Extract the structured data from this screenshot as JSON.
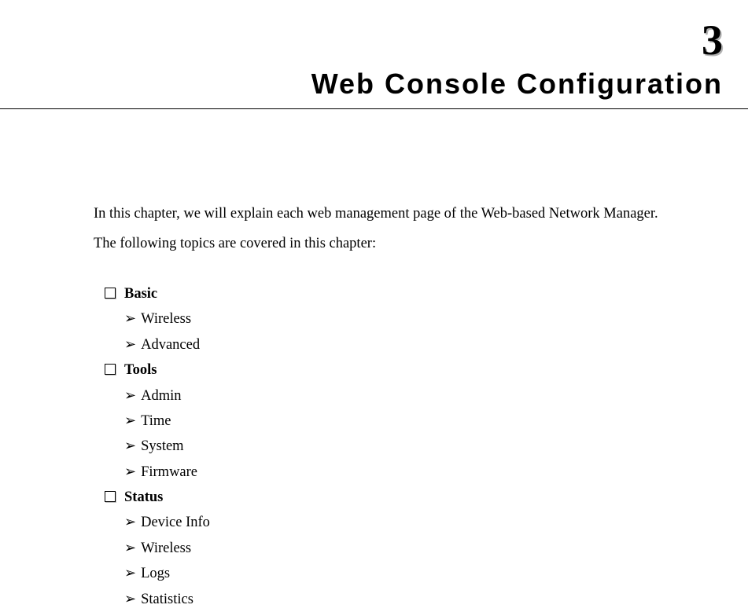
{
  "chapter_number": "3",
  "chapter_title": "Web Console Configuration",
  "intro_line1": "In this chapter, we will explain each web management page of the Web-based Network Manager.",
  "intro_line2": "The following topics are covered in this chapter:",
  "toc": {
    "sections": [
      {
        "label": "Basic",
        "items": [
          "Wireless",
          "Advanced"
        ]
      },
      {
        "label": "Tools",
        "items": [
          "Admin",
          "Time",
          "System",
          "Firmware"
        ]
      },
      {
        "label": "Status",
        "items": [
          "Device Info",
          "Wireless",
          "Logs",
          "Statistics"
        ]
      }
    ]
  },
  "bullets": {
    "sub": "➢"
  }
}
